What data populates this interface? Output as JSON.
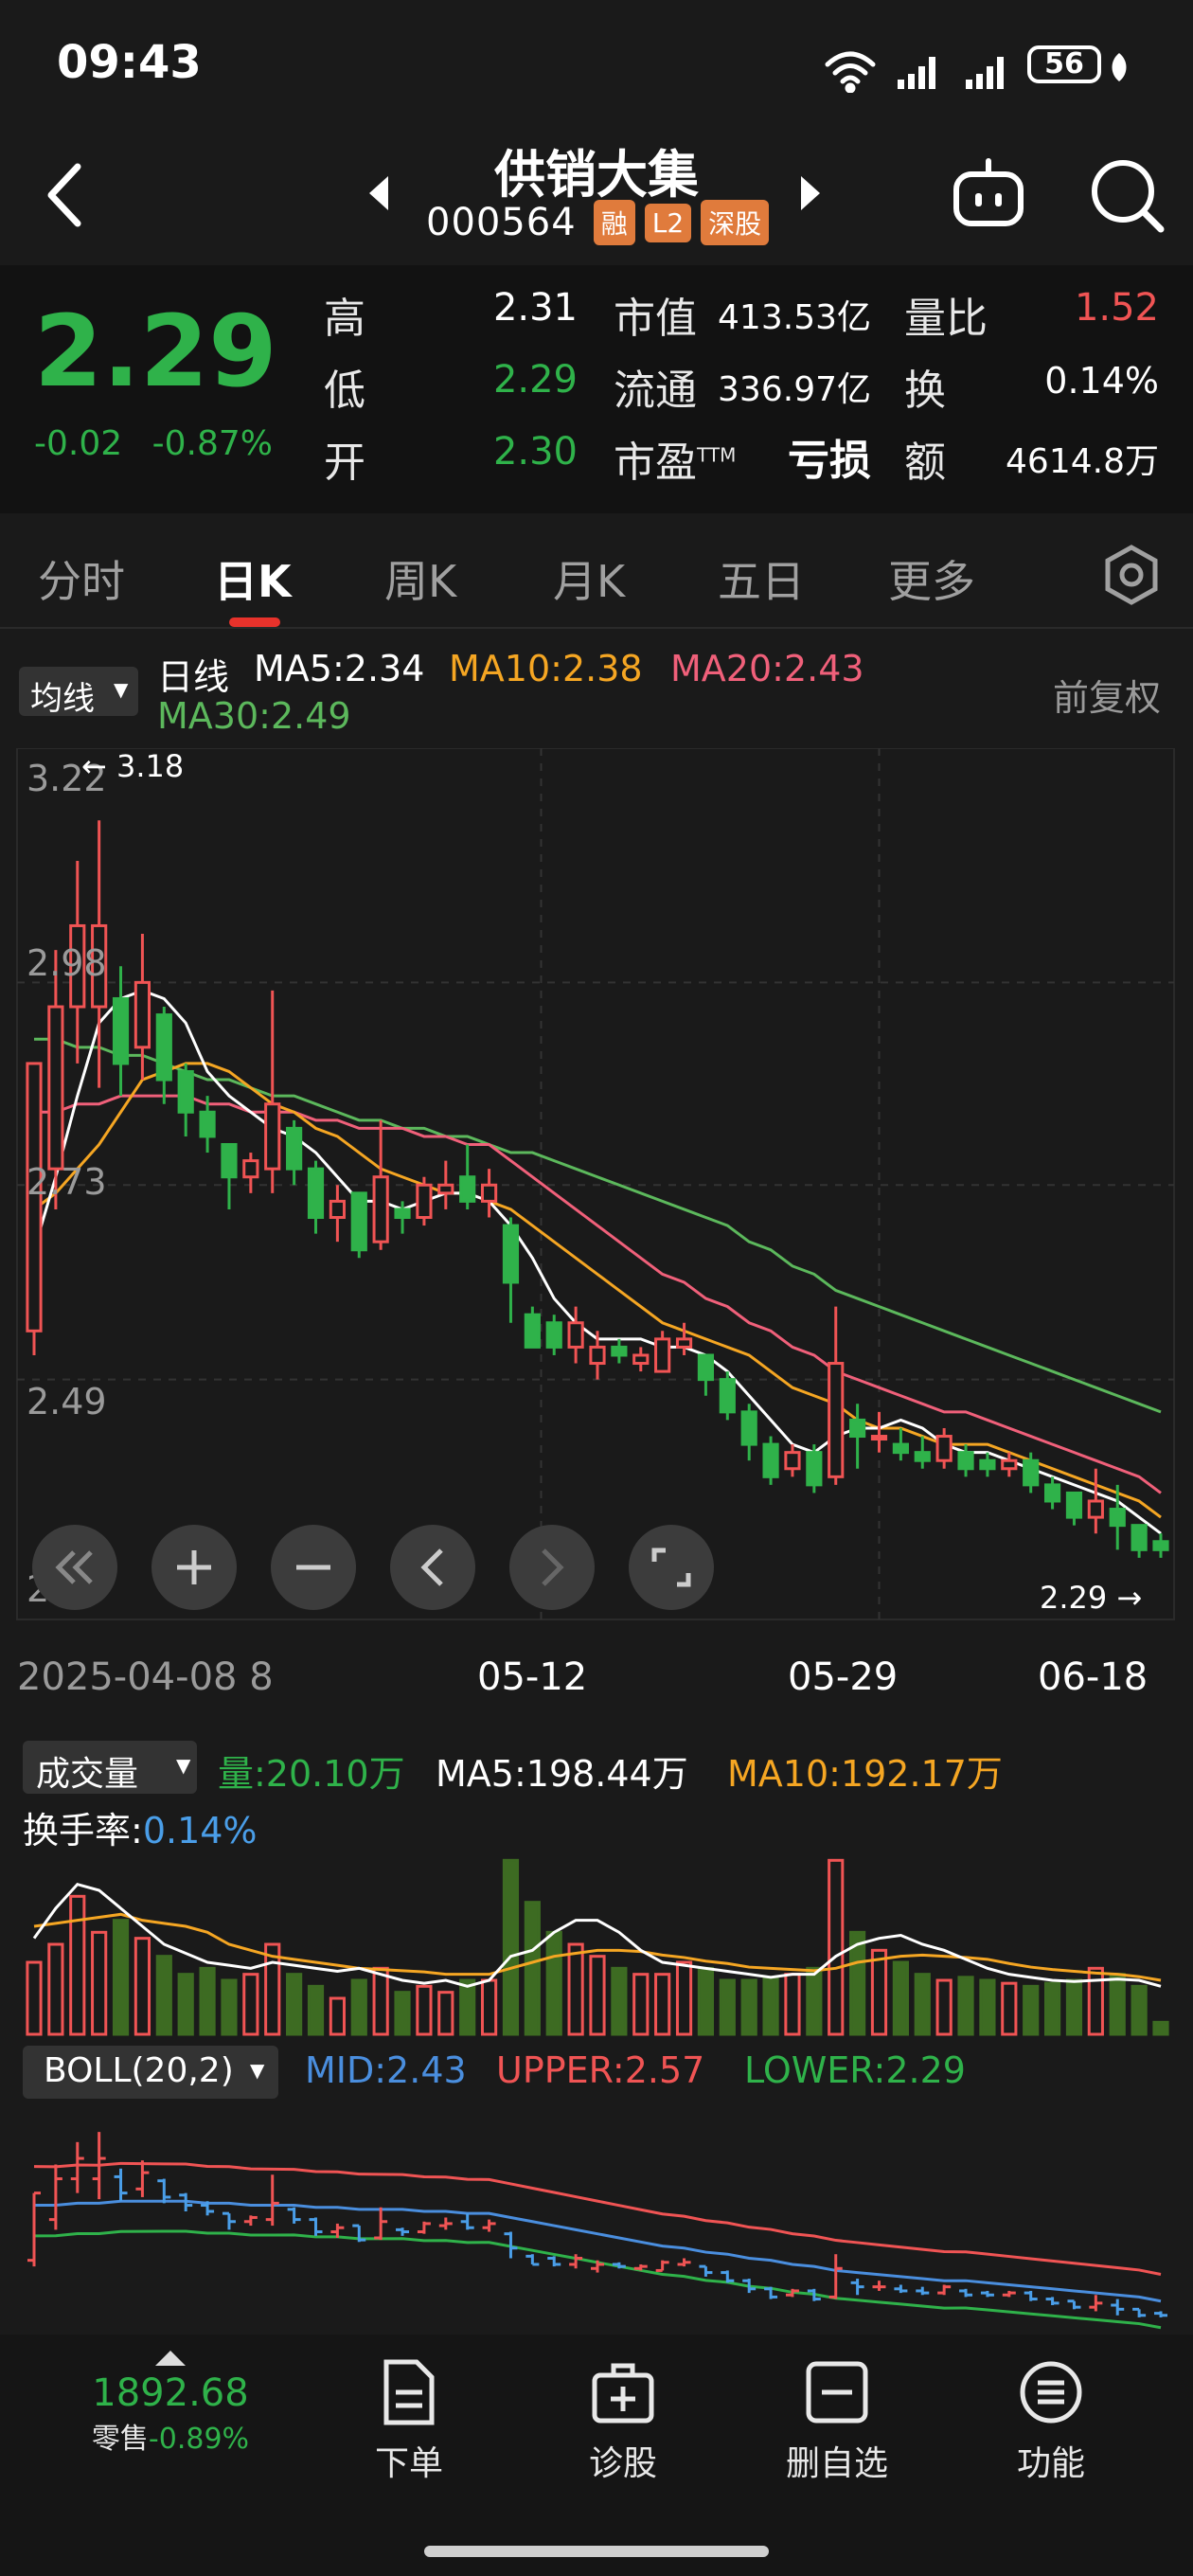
{
  "status": {
    "time": "09:43",
    "battery": "56"
  },
  "stock": {
    "name": "供销大集",
    "code": "000564",
    "tags": [
      "融",
      "L2",
      "深股"
    ]
  },
  "quote": {
    "price": "2.29",
    "change": "-0.02",
    "change_pct": "-0.87%",
    "high_label": "高",
    "high": "2.31",
    "low_label": "低",
    "low": "2.29",
    "open_label": "开",
    "open": "2.30",
    "mktcap_label": "市值",
    "mktcap": "413.53亿",
    "float_label": "流通",
    "float": "336.97亿",
    "pe_label": "市盈",
    "pe_sup": "TTM",
    "pe": "亏损",
    "volratio_label": "量比",
    "volratio": "1.52",
    "turnover_label": "换",
    "turnover": "0.14%",
    "amount_label": "额",
    "amount": "4614.8万"
  },
  "tabs": [
    "分时",
    "日K",
    "周K",
    "月K",
    "五日",
    "更多"
  ],
  "kline": {
    "indicator_select": "均线",
    "period_label": "日线",
    "ma5": "MA5:2.34",
    "ma10": "MA10:2.38",
    "ma20": "MA20:2.43",
    "ma30": "MA30:2.49",
    "adjust": "前复权",
    "high_marker": "3.18",
    "last_marker": "2.29",
    "y_ticks": [
      "3.22",
      "2.98",
      "2.73",
      "2.49",
      "2.25"
    ],
    "x_ticks": [
      "2025-04-08",
      "8",
      "05-12",
      "05-29",
      "06-18"
    ]
  },
  "volume": {
    "select": "成交量",
    "vol": "量:20.10万",
    "ma5": "MA5:198.44万",
    "ma10": "MA10:192.17万",
    "turnover_label": "换手率:",
    "turnover": "0.14%"
  },
  "boll": {
    "select": "BOLL(20,2)",
    "mid": "MID:2.43",
    "upper": "UPPER:2.57",
    "lower": "LOWER:2.29"
  },
  "bottom": {
    "index_value": "1892.68",
    "index_name": "零售",
    "index_change": "-0.89%",
    "nav": [
      "下单",
      "诊股",
      "删自选",
      "功能"
    ]
  },
  "colors": {
    "up": "#f05454",
    "down": "#2fb24a",
    "ma5": "#ffffff",
    "ma10": "#f5a623",
    "ma20": "#f0607a",
    "ma30": "#5cb85c",
    "mid": "#4a8ede"
  },
  "chart_data": {
    "type": "candlestick",
    "y_range": [
      2.25,
      3.22
    ],
    "candles": [
      {
        "o": 2.55,
        "c": 2.88,
        "h": 2.88,
        "l": 2.52
      },
      {
        "o": 2.75,
        "c": 2.95,
        "h": 3.02,
        "l": 2.7
      },
      {
        "o": 2.95,
        "c": 3.05,
        "h": 3.13,
        "l": 2.88
      },
      {
        "o": 2.95,
        "c": 3.05,
        "h": 3.18,
        "l": 2.85
      },
      {
        "o": 2.96,
        "c": 2.88,
        "h": 3.0,
        "l": 2.84
      },
      {
        "o": 2.9,
        "c": 2.98,
        "h": 3.04,
        "l": 2.86
      },
      {
        "o": 2.94,
        "c": 2.86,
        "h": 2.95,
        "l": 2.83
      },
      {
        "o": 2.87,
        "c": 2.82,
        "h": 2.88,
        "l": 2.79
      },
      {
        "o": 2.82,
        "c": 2.79,
        "h": 2.84,
        "l": 2.77
      },
      {
        "o": 2.78,
        "c": 2.74,
        "h": 2.78,
        "l": 2.7
      },
      {
        "o": 2.74,
        "c": 2.76,
        "h": 2.77,
        "l": 2.72
      },
      {
        "o": 2.75,
        "c": 2.83,
        "h": 2.97,
        "l": 2.72
      },
      {
        "o": 2.8,
        "c": 2.75,
        "h": 2.81,
        "l": 2.73
      },
      {
        "o": 2.75,
        "c": 2.69,
        "h": 2.76,
        "l": 2.67
      },
      {
        "o": 2.69,
        "c": 2.71,
        "h": 2.73,
        "l": 2.66
      },
      {
        "o": 2.72,
        "c": 2.65,
        "h": 2.72,
        "l": 2.64
      },
      {
        "o": 2.66,
        "c": 2.74,
        "h": 2.81,
        "l": 2.65
      },
      {
        "o": 2.7,
        "c": 2.69,
        "h": 2.71,
        "l": 2.67
      },
      {
        "o": 2.69,
        "c": 2.73,
        "h": 2.74,
        "l": 2.68
      },
      {
        "o": 2.72,
        "c": 2.73,
        "h": 2.76,
        "l": 2.7
      },
      {
        "o": 2.74,
        "c": 2.71,
        "h": 2.78,
        "l": 2.7
      },
      {
        "o": 2.71,
        "c": 2.73,
        "h": 2.75,
        "l": 2.69
      },
      {
        "o": 2.68,
        "c": 2.61,
        "h": 2.69,
        "l": 2.56
      },
      {
        "o": 2.57,
        "c": 2.53,
        "h": 2.58,
        "l": 2.53
      },
      {
        "o": 2.56,
        "c": 2.53,
        "h": 2.57,
        "l": 2.52
      },
      {
        "o": 2.53,
        "c": 2.56,
        "h": 2.58,
        "l": 2.51
      },
      {
        "o": 2.51,
        "c": 2.53,
        "h": 2.55,
        "l": 2.49
      },
      {
        "o": 2.53,
        "c": 2.52,
        "h": 2.54,
        "l": 2.51
      },
      {
        "o": 2.51,
        "c": 2.52,
        "h": 2.53,
        "l": 2.5
      },
      {
        "o": 2.5,
        "c": 2.54,
        "h": 2.55,
        "l": 2.5
      },
      {
        "o": 2.53,
        "c": 2.54,
        "h": 2.56,
        "l": 2.52
      },
      {
        "o": 2.52,
        "c": 2.49,
        "h": 2.52,
        "l": 2.47
      },
      {
        "o": 2.49,
        "c": 2.45,
        "h": 2.5,
        "l": 2.44
      },
      {
        "o": 2.45,
        "c": 2.41,
        "h": 2.46,
        "l": 2.39
      },
      {
        "o": 2.41,
        "c": 2.37,
        "h": 2.42,
        "l": 2.36
      },
      {
        "o": 2.38,
        "c": 2.4,
        "h": 2.41,
        "l": 2.37
      },
      {
        "o": 2.4,
        "c": 2.36,
        "h": 2.41,
        "l": 2.35
      },
      {
        "o": 2.37,
        "c": 2.51,
        "h": 2.58,
        "l": 2.36
      },
      {
        "o": 2.44,
        "c": 2.42,
        "h": 2.46,
        "l": 2.38
      },
      {
        "o": 2.42,
        "c": 2.42,
        "h": 2.45,
        "l": 2.4
      },
      {
        "o": 2.41,
        "c": 2.4,
        "h": 2.43,
        "l": 2.39
      },
      {
        "o": 2.4,
        "c": 2.39,
        "h": 2.42,
        "l": 2.38
      },
      {
        "o": 2.39,
        "c": 2.42,
        "h": 2.43,
        "l": 2.38
      },
      {
        "o": 2.4,
        "c": 2.38,
        "h": 2.41,
        "l": 2.37
      },
      {
        "o": 2.39,
        "c": 2.38,
        "h": 2.4,
        "l": 2.37
      },
      {
        "o": 2.38,
        "c": 2.39,
        "h": 2.4,
        "l": 2.37
      },
      {
        "o": 2.39,
        "c": 2.36,
        "h": 2.4,
        "l": 2.35
      },
      {
        "o": 2.36,
        "c": 2.34,
        "h": 2.37,
        "l": 2.33
      },
      {
        "o": 2.35,
        "c": 2.32,
        "h": 2.35,
        "l": 2.31
      },
      {
        "o": 2.32,
        "c": 2.34,
        "h": 2.38,
        "l": 2.3
      },
      {
        "o": 2.33,
        "c": 2.31,
        "h": 2.36,
        "l": 2.28
      },
      {
        "o": 2.31,
        "c": 2.28,
        "h": 2.31,
        "l": 2.27
      },
      {
        "o": 2.29,
        "c": 2.28,
        "h": 2.3,
        "l": 2.27
      }
    ],
    "ma5": [
      2.65,
      2.74,
      2.84,
      2.93,
      2.96,
      2.97,
      2.96,
      2.93,
      2.87,
      2.84,
      2.82,
      2.8,
      2.79,
      2.77,
      2.74,
      2.71,
      2.71,
      2.7,
      2.71,
      2.72,
      2.72,
      2.71,
      2.68,
      2.64,
      2.59,
      2.56,
      2.54,
      2.54,
      2.54,
      2.53,
      2.53,
      2.52,
      2.5,
      2.47,
      2.44,
      2.41,
      2.4,
      2.42,
      2.43,
      2.43,
      2.44,
      2.43,
      2.41,
      2.4,
      2.4,
      2.39,
      2.38,
      2.37,
      2.36,
      2.35,
      2.34,
      2.32,
      2.3
    ],
    "ma10": [
      2.7,
      2.72,
      2.75,
      2.78,
      2.82,
      2.86,
      2.87,
      2.88,
      2.88,
      2.87,
      2.85,
      2.83,
      2.82,
      2.8,
      2.79,
      2.77,
      2.75,
      2.74,
      2.73,
      2.72,
      2.72,
      2.71,
      2.7,
      2.68,
      2.66,
      2.64,
      2.62,
      2.6,
      2.58,
      2.56,
      2.55,
      2.54,
      2.53,
      2.52,
      2.5,
      2.48,
      2.47,
      2.46,
      2.44,
      2.43,
      2.43,
      2.42,
      2.41,
      2.41,
      2.41,
      2.4,
      2.39,
      2.38,
      2.37,
      2.36,
      2.35,
      2.34,
      2.32
    ],
    "ma20": [
      2.82,
      2.82,
      2.83,
      2.83,
      2.84,
      2.84,
      2.84,
      2.84,
      2.83,
      2.83,
      2.82,
      2.82,
      2.82,
      2.81,
      2.81,
      2.8,
      2.8,
      2.8,
      2.79,
      2.79,
      2.78,
      2.78,
      2.76,
      2.74,
      2.72,
      2.7,
      2.68,
      2.66,
      2.64,
      2.62,
      2.61,
      2.59,
      2.58,
      2.56,
      2.55,
      2.53,
      2.52,
      2.5,
      2.49,
      2.48,
      2.47,
      2.46,
      2.45,
      2.45,
      2.44,
      2.43,
      2.42,
      2.41,
      2.4,
      2.39,
      2.38,
      2.37,
      2.35
    ],
    "ma30": [
      2.91,
      2.91,
      2.9,
      2.9,
      2.89,
      2.89,
      2.88,
      2.87,
      2.86,
      2.86,
      2.85,
      2.84,
      2.84,
      2.83,
      2.82,
      2.81,
      2.81,
      2.8,
      2.8,
      2.79,
      2.79,
      2.78,
      2.77,
      2.77,
      2.76,
      2.75,
      2.74,
      2.73,
      2.72,
      2.71,
      2.7,
      2.69,
      2.68,
      2.66,
      2.65,
      2.63,
      2.62,
      2.6,
      2.59,
      2.58,
      2.57,
      2.56,
      2.55,
      2.54,
      2.53,
      2.52,
      2.51,
      2.5,
      2.49,
      2.48,
      2.47,
      2.46,
      2.45
    ],
    "volume": [
      120,
      150,
      230,
      170,
      190,
      160,
      130,
      100,
      110,
      90,
      100,
      150,
      100,
      80,
      60,
      90,
      110,
      70,
      80,
      70,
      90,
      90,
      290,
      220,
      170,
      150,
      130,
      110,
      100,
      100,
      120,
      110,
      90,
      90,
      95,
      100,
      110,
      290,
      170,
      140,
      120,
      100,
      90,
      95,
      90,
      85,
      80,
      85,
      90,
      110,
      100,
      80,
      20
    ],
    "volume_ma5": [
      160,
      210,
      250,
      240,
      210,
      180,
      150,
      135,
      120,
      115,
      110,
      120,
      115,
      110,
      105,
      110,
      100,
      90,
      85,
      90,
      80,
      90,
      130,
      140,
      170,
      190,
      190,
      170,
      140,
      120,
      115,
      110,
      105,
      100,
      95,
      100,
      100,
      130,
      150,
      160,
      165,
      150,
      140,
      125,
      110,
      100,
      95,
      90,
      88,
      90,
      92,
      90,
      80
    ],
    "volume_ma10": [
      180,
      185,
      190,
      195,
      200,
      190,
      185,
      180,
      170,
      150,
      140,
      130,
      125,
      120,
      115,
      110,
      108,
      106,
      104,
      100,
      100,
      100,
      110,
      120,
      130,
      135,
      140,
      140,
      138,
      132,
      128,
      122,
      118,
      112,
      110,
      108,
      106,
      110,
      120,
      125,
      130,
      132,
      130,
      128,
      125,
      118,
      112,
      108,
      105,
      102,
      100,
      96,
      90
    ]
  }
}
